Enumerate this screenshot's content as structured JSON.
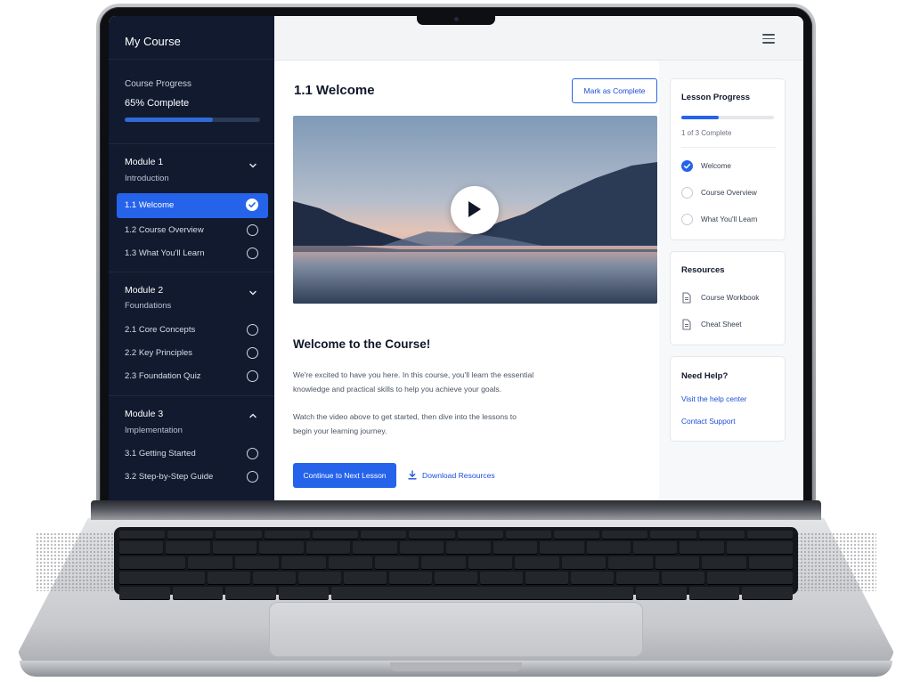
{
  "sidebar": {
    "app_title": "My Course",
    "progress_label": "Course Progress",
    "progress_text": "65% Complete",
    "progress_value": 0.65,
    "modules": [
      {
        "title": "Module 1",
        "subtitle": "Introduction",
        "expanded": true,
        "lessons": [
          {
            "label": "1.1 Welcome",
            "status": "complete",
            "active": true
          },
          {
            "label": "1.2 Course Overview",
            "status": "incomplete",
            "active": false
          },
          {
            "label": "1.3 What You'll Learn",
            "status": "incomplete",
            "active": false
          }
        ]
      },
      {
        "title": "Module 2",
        "subtitle": "Foundations",
        "expanded": true,
        "lessons": [
          {
            "label": "2.1 Core Concepts",
            "status": "incomplete",
            "active": false
          },
          {
            "label": "2.2 Key Principles",
            "status": "incomplete",
            "active": false
          },
          {
            "label": "2.3 Foundation Quiz",
            "status": "incomplete",
            "active": false
          }
        ]
      },
      {
        "title": "Module 3",
        "subtitle": "Implementation",
        "expanded": true,
        "lessons": [
          {
            "label": "3.1 Getting Started",
            "status": "incomplete",
            "active": false
          },
          {
            "label": "3.2 Step-by-Step Guide",
            "status": "incomplete",
            "active": false
          }
        ]
      }
    ]
  },
  "topbar": {
    "menu_icon": "hamburger-menu-icon"
  },
  "main": {
    "lesson_title": "1.1 Welcome",
    "mark_complete_label": "Mark as Complete",
    "video_icon": "play-icon",
    "heading": "Welcome to the Course!",
    "paragraphs": [
      [
        "We're excited to have you here. In this course, you'll learn the essential",
        "knowledge and practical skills to help you achieve your goals."
      ],
      [
        "Watch the video above to get started, then dive into the lessons to",
        "begin your learning journey."
      ]
    ],
    "continue_label": "Continue to Next Lesson",
    "download_label": "Download Resources"
  },
  "right_panel": {
    "lesson_progress": {
      "title": "Lesson Progress",
      "count_text": "1 of 3 Complete",
      "progress_value": 0.4,
      "items": [
        {
          "label": "Welcome",
          "status": "complete"
        },
        {
          "label": "Course Overview",
          "status": "incomplete"
        },
        {
          "label": "What You'll Learn",
          "status": "incomplete"
        }
      ]
    },
    "resources": {
      "title": "Resources",
      "items": [
        {
          "label": "Course Workbook",
          "icon": "document-icon"
        },
        {
          "label": "Cheat Sheet",
          "icon": "document-icon"
        }
      ]
    },
    "help": {
      "title": "Need Help?",
      "links": [
        "Visit the help center",
        "Contact Support"
      ]
    }
  },
  "colors": {
    "sidebar_bg": "#111a2e",
    "accent": "#2563eb",
    "link": "#1d4ed8"
  }
}
